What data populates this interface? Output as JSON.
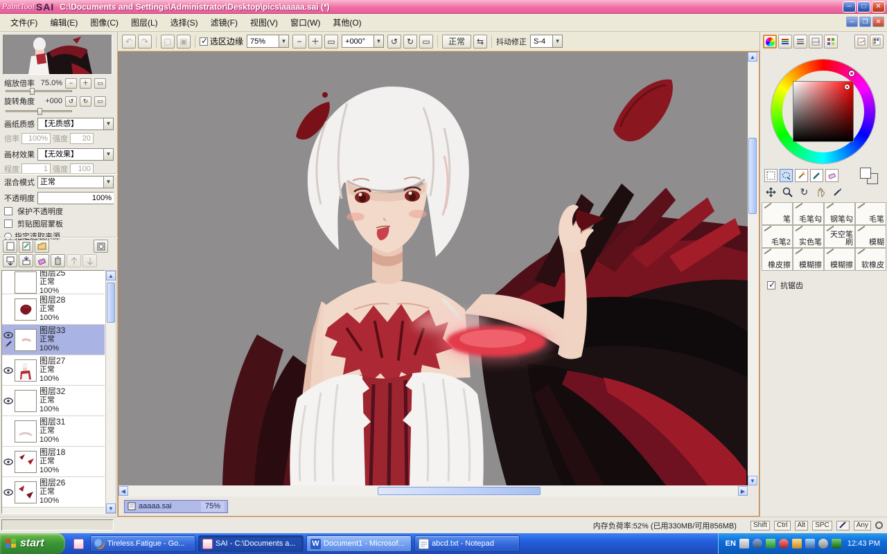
{
  "colors": {
    "titlebar_pink": "#ef6fa6",
    "taskbar_blue": "#245edb",
    "selection_periwinkle": "#aab4e4",
    "canvas_gray": "#8f8d8e",
    "wing_dark_red": "#771420",
    "accent_red": "#c9414b"
  },
  "titlebar": {
    "logo_paint": "PaintTool",
    "logo_sai": "SAI",
    "title": "C:\\Documents and Settings\\Administrator\\Desktop\\pics\\aaaaa.sai (*)"
  },
  "menu": {
    "items": [
      "文件(F)",
      "编辑(E)",
      "图像(C)",
      "图层(L)",
      "选择(S)",
      "滤镜(F)",
      "视图(V)",
      "窗口(W)",
      "其他(O)"
    ]
  },
  "toolbar": {
    "selection_edge": "选区边缘",
    "zoom": "75%",
    "angle": "+000°",
    "normal": "正常",
    "jitter_label": "抖动修正",
    "jitter_value": "S-4"
  },
  "navigator": {
    "zoom_label": "缩放倍率",
    "zoom_value": "75.0%",
    "rotate_label": "旋转角度",
    "rotate_value": "+000"
  },
  "paper": {
    "texture_label": "画纸质感",
    "texture_value": "【无质感】",
    "scale_label": "倍率",
    "scale_value": "100%",
    "strength_label": "强度",
    "strength_value": "20",
    "effect_label": "画材效果",
    "effect_value": "【无效果】",
    "degree_label": "程度",
    "degree_value": "1",
    "strength2_label": "强度",
    "strength2_value": "100"
  },
  "layer_props": {
    "blend_label": "混合模式",
    "blend_value": "正常",
    "opacity_label": "不透明度",
    "opacity_value": "100%",
    "protect": "保护不透明度",
    "clip": "剪贴图层蒙板",
    "source": "指定选取来源"
  },
  "layers": [
    {
      "name": "图层25",
      "mode": "正常",
      "opacity": "100%",
      "visible": false,
      "selected": false
    },
    {
      "name": "图层28",
      "mode": "正常",
      "opacity": "100%",
      "visible": false,
      "selected": false
    },
    {
      "name": "图层33",
      "mode": "正常",
      "opacity": "100%",
      "visible": true,
      "selected": true
    },
    {
      "name": "图层27",
      "mode": "正常",
      "opacity": "100%",
      "visible": true,
      "selected": false
    },
    {
      "name": "图层32",
      "mode": "正常",
      "opacity": "100%",
      "visible": true,
      "selected": false
    },
    {
      "name": "图层31",
      "mode": "正常",
      "opacity": "100%",
      "visible": false,
      "selected": false
    },
    {
      "name": "图层18",
      "mode": "正常",
      "opacity": "100%",
      "visible": true,
      "selected": false
    },
    {
      "name": "图层26",
      "mode": "正常",
      "opacity": "100%",
      "visible": true,
      "selected": false
    }
  ],
  "doc_tab": {
    "name": "aaaaa.sai",
    "zoom": "75%"
  },
  "brushes": {
    "names": [
      "笔",
      "毛笔勾",
      "钢笔勾",
      "毛笔",
      "毛笔2",
      "实色笔",
      "天空笔刷",
      "模糊",
      "橡皮擦",
      "模糊擦",
      "模糊擦",
      "软橡皮"
    ],
    "antialias": "抗锯齿"
  },
  "status": {
    "memory": "内存负荷率:52% (已用330MB/可用856MB)",
    "keys": [
      "Shift",
      "Ctrl",
      "Alt",
      "SPC"
    ],
    "any": "Any"
  },
  "taskbar": {
    "start": "start",
    "tasks": [
      "Tireless.Fatigue - Go...",
      "SAI - C:\\Documents a...",
      "Document1 - Microsof...",
      "abcd.txt - Notepad"
    ],
    "lang": "EN",
    "time": "12:43 PM"
  }
}
